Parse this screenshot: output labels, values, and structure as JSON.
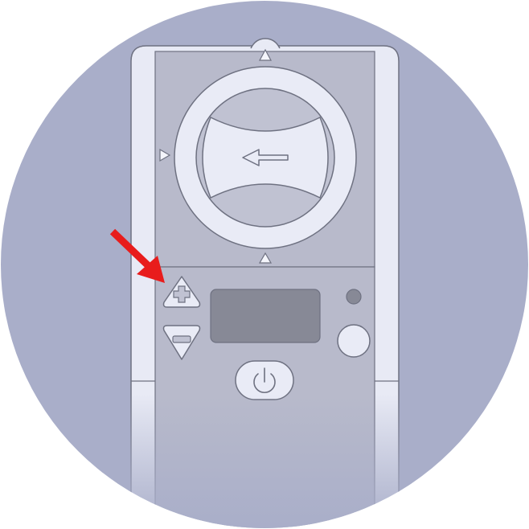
{
  "device": {
    "description_colors": {
      "background_circle": "#a9aec9",
      "device_body": "#e8eaf5",
      "panel": "#b8bacb",
      "dial_ring": "#e9ebf6",
      "dial_center": "#b7b9cb",
      "display_screen": "#878996",
      "outline": "#6e7181",
      "highlight_arrow": "#e81c1c"
    },
    "icons": {
      "dial_arrow": "left-arrow-icon",
      "plus_button": "plus-icon",
      "minus_button": "minus-icon",
      "power_button": "power-icon",
      "indicator": "indicator-led",
      "round_button": "round-button",
      "pointer": "red-pointer-arrow"
    },
    "highlighted_control": "plus-button"
  }
}
